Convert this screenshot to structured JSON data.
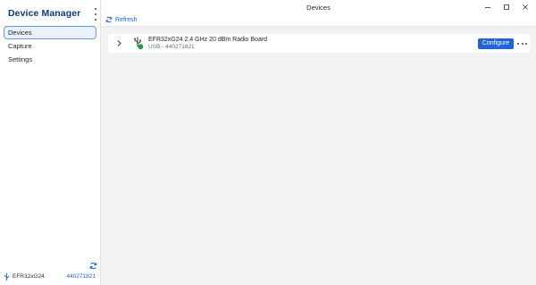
{
  "app": {
    "title": "Device Manager"
  },
  "sidebar": {
    "items": [
      {
        "label": "Devices",
        "active": true
      },
      {
        "label": "Capture",
        "active": false
      },
      {
        "label": "Settings",
        "active": false
      }
    ],
    "footer": {
      "device": "EFR32xG24",
      "serial": "440271821",
      "icons": [
        "refresh-icon",
        "usb-icon"
      ]
    }
  },
  "window": {
    "title": "Devices",
    "controls": [
      "minimize-icon",
      "maximize-icon",
      "close-icon"
    ]
  },
  "toolbar": {
    "refresh_label": "Refresh"
  },
  "devices": [
    {
      "name": "EFR32xG24 2.4 GHz 20 dBm Radio Board",
      "subtitle": "USB - 440271821",
      "status_color": "#1e9e4a",
      "action_label": "Configure"
    }
  ],
  "colors": {
    "accent": "#1f64d8",
    "title": "#0b3a82",
    "active_bg": "#e9f1fc",
    "content_bg": "#f1f2f4"
  }
}
